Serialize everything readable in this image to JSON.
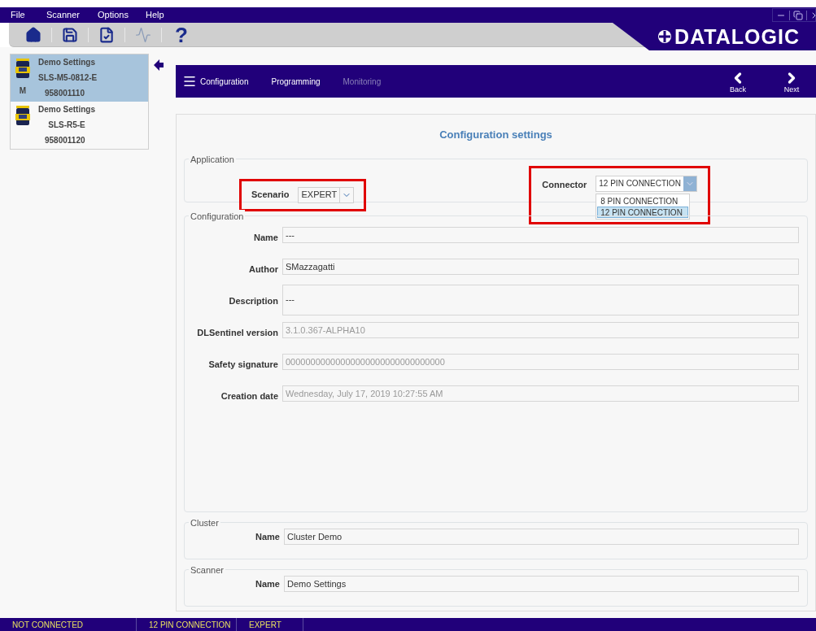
{
  "menu": [
    "File",
    "Scanner",
    "Options",
    "Help"
  ],
  "toolbar": [
    {
      "kind": "home",
      "disabled": false
    },
    {
      "kind": "save",
      "disabled": false
    },
    {
      "kind": "validate",
      "disabled": false
    },
    {
      "kind": "monitor",
      "disabled": true
    },
    {
      "kind": "help",
      "text": "?",
      "disabled": false
    }
  ],
  "logo": "DATALOGIC",
  "devices": [
    {
      "title": "Demo Settings",
      "model": "SLS-M5-0812-E",
      "badge": "M",
      "serial": "958001110",
      "selected": true
    },
    {
      "title": "Demo Settings",
      "model": "SLS-R5-E",
      "serial": "958001120",
      "selected": false
    }
  ],
  "nav": {
    "tabs": [
      {
        "label": "Configuration",
        "disabled": false
      },
      {
        "label": "Programming",
        "disabled": false
      },
      {
        "label": "Monitoring",
        "disabled": true
      }
    ],
    "back": "Back",
    "next": "Next"
  },
  "page": {
    "title": "Configuration settings",
    "application": {
      "legend": "Application",
      "scenario": {
        "label": "Scenario",
        "value": "EXPERT",
        "highlighted": true
      },
      "connector": {
        "label": "Connector",
        "value": "12 PIN CONNECTION",
        "highlighted": true,
        "expanded": true,
        "options": [
          {
            "label": "8 PIN CONNECTION",
            "selected": false
          },
          {
            "label": "12 PIN CONNECTION",
            "selected": true
          }
        ]
      }
    },
    "configuration": {
      "legend": "Configuration",
      "fields": [
        {
          "label": "Name",
          "value": "---",
          "disabled": false,
          "multiline": false
        },
        {
          "label": "Author",
          "value": "SMazzagatti",
          "disabled": false,
          "multiline": false
        },
        {
          "label": "Description",
          "value": "---",
          "disabled": false,
          "multiline": true
        },
        {
          "label": "DLSentinel version",
          "value": "3.1.0.367-ALPHA10",
          "disabled": true,
          "multiline": false
        },
        {
          "label": "Safety signature",
          "value": "00000000000000000000000000000000",
          "disabled": true,
          "multiline": false
        },
        {
          "label": "Creation date",
          "value": "Wednesday, July 17, 2019 10:27:55 AM",
          "disabled": true,
          "multiline": false
        }
      ]
    },
    "cluster": {
      "legend": "Cluster",
      "label": "Name",
      "value": "Cluster Demo"
    },
    "scanner": {
      "legend": "Scanner",
      "label": "Name",
      "value": "Demo Settings"
    }
  },
  "status_bar": [
    "NOT CONNECTED",
    "12 PIN CONNECTION",
    "EXPERT"
  ]
}
